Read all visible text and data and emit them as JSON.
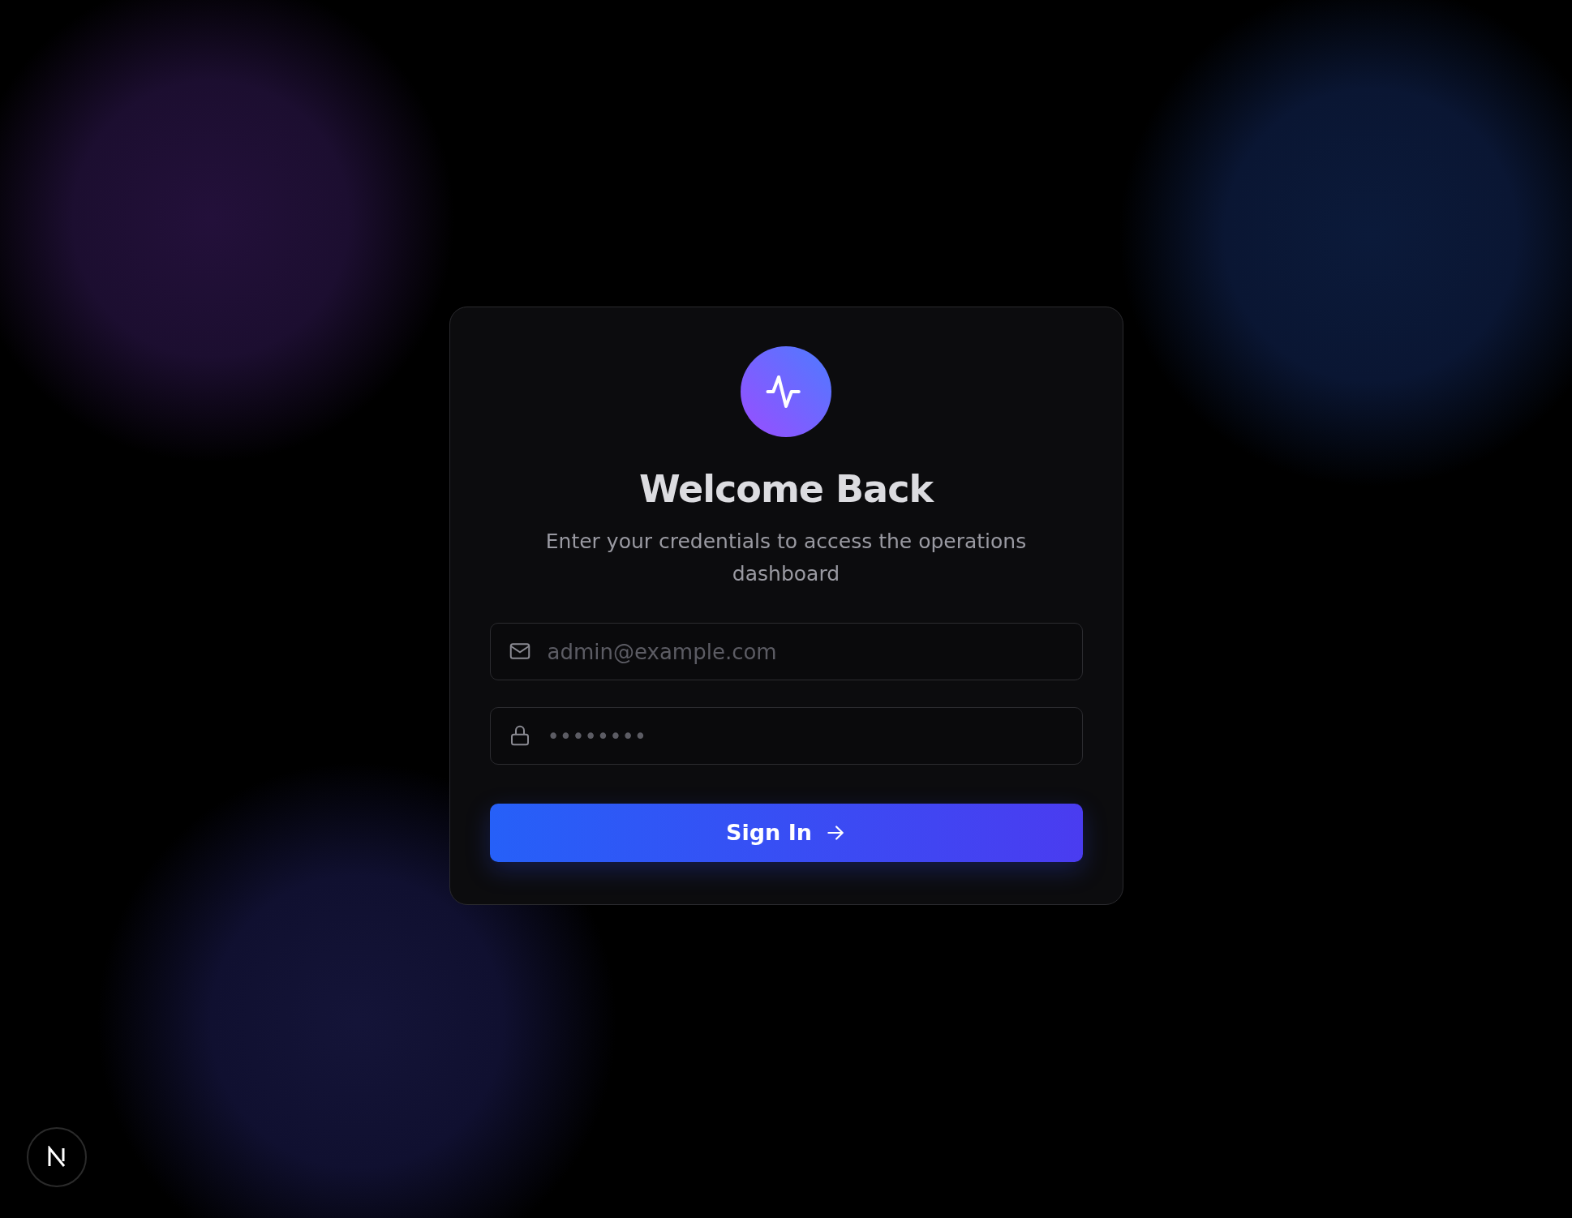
{
  "login": {
    "title": "Welcome Back",
    "subtitle": "Enter your credentials to access the operations dashboard",
    "fields": [
      {
        "kind": "email",
        "placeholder": "admin@example.com"
      },
      {
        "kind": "password",
        "placeholder": "••••••••"
      }
    ],
    "button": "Sign In"
  }
}
